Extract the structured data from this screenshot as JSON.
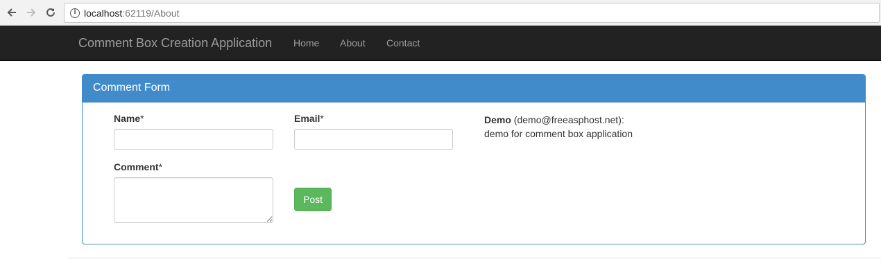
{
  "browser": {
    "url_host": "localhost",
    "url_rest": ":62119/About",
    "icons": [
      "back-arrow-icon",
      "forward-arrow-icon",
      "reload-icon",
      "info-icon"
    ]
  },
  "navbar": {
    "brand": "Comment Box Creation Application",
    "links": [
      "Home",
      "About",
      "Contact"
    ],
    "background": "#222222",
    "link_color": "#9d9d9d"
  },
  "panel": {
    "title": "Comment Form",
    "accent": "#428bca",
    "fields": {
      "name_label": "Name",
      "email_label": "Email",
      "comment_label": "Comment",
      "required_mark": "*",
      "name_value": "",
      "email_value": "",
      "comment_value": ""
    },
    "post_label": "Post",
    "post_color": "#5cb85c",
    "comment": {
      "name": "Demo",
      "email_part": " (demo@freeasphost.net):",
      "text": "demo for comment box application"
    }
  }
}
